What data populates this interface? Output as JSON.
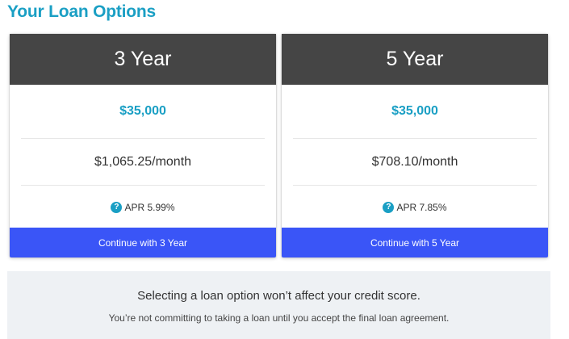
{
  "page": {
    "title": "Your Loan Options"
  },
  "options": [
    {
      "term": "3 Year",
      "amount": "$35,000",
      "monthly": "$1,065.25/month",
      "apr": "APR 5.99%",
      "button_label": "Continue with 3 Year"
    },
    {
      "term": "5 Year",
      "amount": "$35,000",
      "monthly": "$708.10/month",
      "apr": "APR 7.85%",
      "button_label": "Continue with 5 Year"
    }
  ],
  "help_icon_glyph": "?",
  "notice": {
    "title": "Selecting a loan option won’t affect your credit score.",
    "subtitle": "You’re not committing to taking a loan until you accept the final loan agreement."
  },
  "colors": {
    "accent": "#1a9fc4",
    "header_bg": "#454545",
    "button_bg": "#3a55f7",
    "notice_bg": "#eef1f4"
  },
  "icons": {
    "help": "question-circle-icon"
  }
}
